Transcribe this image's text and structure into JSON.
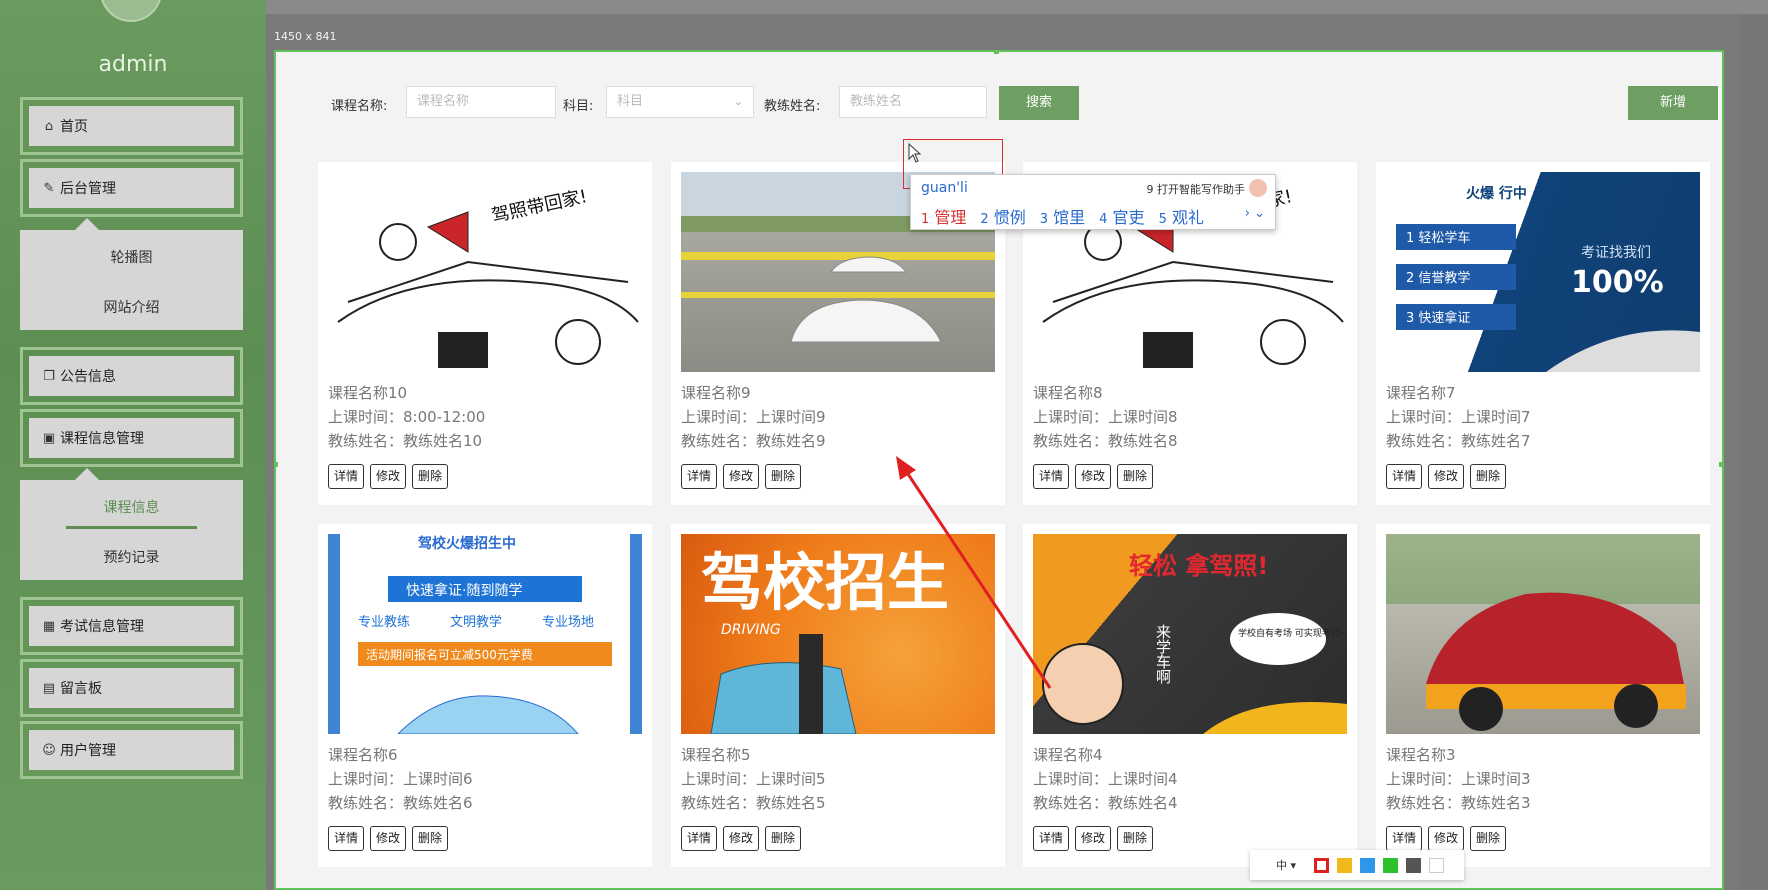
{
  "user": {
    "name": "admin"
  },
  "dims": "1450 x 841",
  "nav": {
    "home": "首页",
    "backend": "后台管理",
    "backend_sub": [
      "轮播图",
      "网站介绍"
    ],
    "notice": "公告信息",
    "course_mgmt": "课程信息管理",
    "course_sub": [
      "课程信息",
      "预约记录"
    ],
    "exam": "考试信息管理",
    "board": "留言板",
    "users": "用户管理"
  },
  "search": {
    "course_label": "课程名称:",
    "course_placeholder": "课程名称",
    "subject_label": "科目:",
    "subject_placeholder": "科目",
    "coach_label": "教练姓名:",
    "coach_placeholder": "教练姓名",
    "search_btn": "搜索",
    "add_btn": "新增"
  },
  "actions": {
    "detail": "详情",
    "edit": "修改",
    "delete": "删除"
  },
  "cards": [
    {
      "title": "课程名称10",
      "time": "上课时间：8:00-12:00",
      "coach": "教练姓名：教练姓名10",
      "art": "sketch",
      "caption": "驾照带回家!"
    },
    {
      "title": "课程名称9",
      "time": "上课时间：上课时间9",
      "coach": "教练姓名：教练姓名9",
      "art": "track",
      "caption": ""
    },
    {
      "title": "课程名称8",
      "time": "上课时间：上课时间8",
      "coach": "教练姓名：教练姓名8",
      "art": "sketch",
      "caption": "驾照带回家!"
    },
    {
      "title": "课程名称7",
      "time": "上课时间：上课时间7",
      "coach": "教练姓名：教练姓名7",
      "art": "blue",
      "caption": ""
    },
    {
      "title": "课程名称6",
      "time": "上课时间：上课时间6",
      "coach": "教练姓名：教练姓名6",
      "art": "poster",
      "caption": ""
    },
    {
      "title": "课程名称5",
      "time": "上课时间：上课时间5",
      "coach": "教练姓名：教练姓名5",
      "art": "orange",
      "caption": ""
    },
    {
      "title": "课程名称4",
      "time": "上课时间：上课时间4",
      "coach": "教练姓名：教练姓名4",
      "art": "dark",
      "caption": ""
    },
    {
      "title": "课程名称3",
      "time": "上课时间：上课时间3",
      "coach": "教练姓名：教练姓名3",
      "art": "car",
      "caption": ""
    }
  ],
  "art_text": {
    "blue_items": [
      "1 轻松学车",
      "2 信誉教学",
      "3 快速拿证"
    ],
    "blue_slogan": "考证找我们",
    "blue_big": "100%",
    "blue_top": "火爆  行中",
    "poster_top": "驾校火爆招生中",
    "poster_line1": "快速拿证·随到随学",
    "poster_line2": [
      "专业教练",
      "文明教学",
      "专业场地"
    ],
    "poster_line3": "活动期间报名可立减500元学费",
    "orange_big": "驾校招生",
    "orange_sub": "DRIVING",
    "dark_big": "轻松 拿驾照!",
    "dark_side": "来学车啊",
    "dark_bubble": "学校自有考场 可实现考训一体化"
  },
  "ime": {
    "typed": "guan'li",
    "assist": "9 打开智能写作助手",
    "candidates": [
      {
        "n": "1",
        "w": "管理"
      },
      {
        "n": "2",
        "w": "惯例"
      },
      {
        "n": "3",
        "w": "馆里"
      },
      {
        "n": "4",
        "w": "官吏"
      },
      {
        "n": "5",
        "w": "观礼"
      }
    ],
    "more": "› ⌄"
  },
  "toolstrip": {
    "lang": "中 ▾",
    "colors": [
      "#e02020",
      "#f2b81c",
      "#2f97ea",
      "#2ec12e",
      "#555555",
      "#ffffff"
    ]
  }
}
